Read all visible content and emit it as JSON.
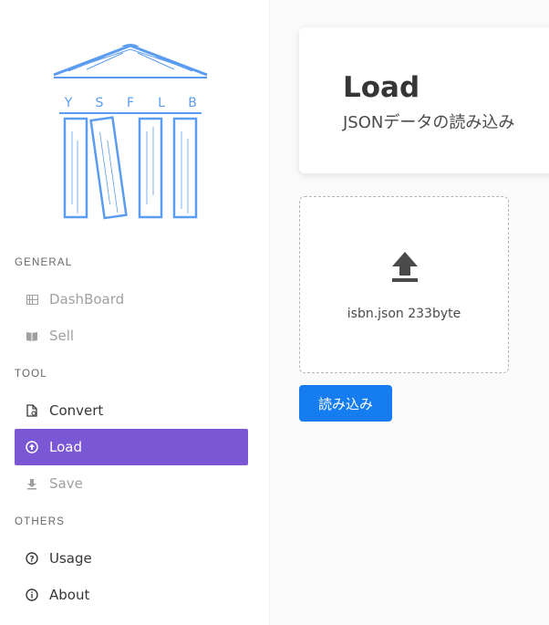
{
  "sidebar": {
    "logo_letters": [
      "Y",
      "S",
      "F",
      "L",
      "B"
    ],
    "sections": [
      {
        "title": "GENERAL",
        "items": [
          {
            "label": "DashBoard",
            "icon": "view-dashboard-icon",
            "state": "disabled"
          },
          {
            "label": "Sell",
            "icon": "book-open-icon",
            "state": "disabled"
          }
        ]
      },
      {
        "title": "TOOL",
        "items": [
          {
            "label": "Convert",
            "icon": "file-convert-icon",
            "state": "normal"
          },
          {
            "label": "Load",
            "icon": "upload-circle-icon",
            "state": "active"
          },
          {
            "label": "Save",
            "icon": "download-icon",
            "state": "disabled"
          }
        ]
      },
      {
        "title": "OTHERS",
        "items": [
          {
            "label": "Usage",
            "icon": "help-circle-icon",
            "state": "normal"
          },
          {
            "label": "About",
            "icon": "info-circle-icon",
            "state": "normal"
          }
        ]
      }
    ]
  },
  "main": {
    "title": "Load",
    "subtitle": "JSONデータの読み込み",
    "dropzone": {
      "file_info": "isbn.json 233byte",
      "icon": "upload-icon"
    },
    "load_button_label": "読み込み"
  },
  "colors": {
    "accent": "#7957d5",
    "primary_button": "#167df0",
    "logo_blue": "#5b9cf0"
  }
}
